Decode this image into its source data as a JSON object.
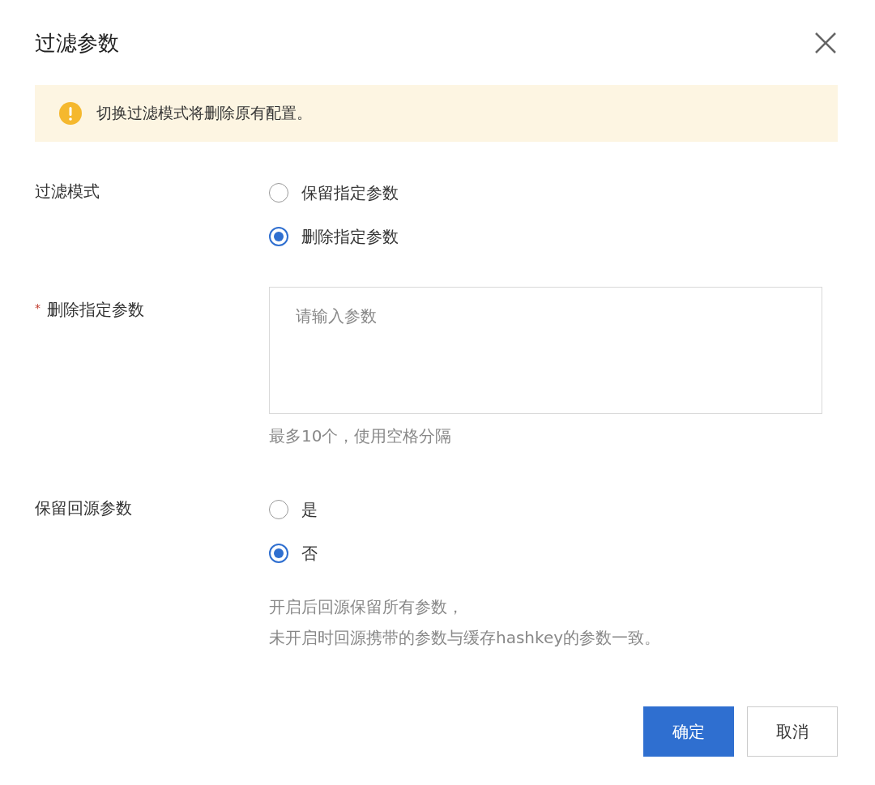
{
  "dialog": {
    "title": "过滤参数"
  },
  "alert": {
    "text": "切换过滤模式将删除原有配置。"
  },
  "form": [
    {
      "kind": "radio",
      "label": "过滤模式",
      "options": [
        {
          "label": "保留指定参数",
          "selected": false
        },
        {
          "label": "删除指定参数",
          "selected": true
        }
      ]
    },
    {
      "kind": "textarea",
      "label": "删除指定参数",
      "required_mark": "*",
      "placeholder": "请输入参数",
      "hint": "最多10个，使用空格分隔"
    },
    {
      "kind": "radio",
      "label": "保留回源参数",
      "options": [
        {
          "label": "是",
          "selected": false
        },
        {
          "label": "否",
          "selected": true
        }
      ],
      "hint": "开启后回源保留所有参数，未开启时回源携带的参数与缓存hashkey的参数一致。"
    }
  ],
  "buttons": [
    {
      "label": "确定",
      "kind": "primary"
    },
    {
      "label": "取消",
      "kind": "secondary"
    }
  ]
}
